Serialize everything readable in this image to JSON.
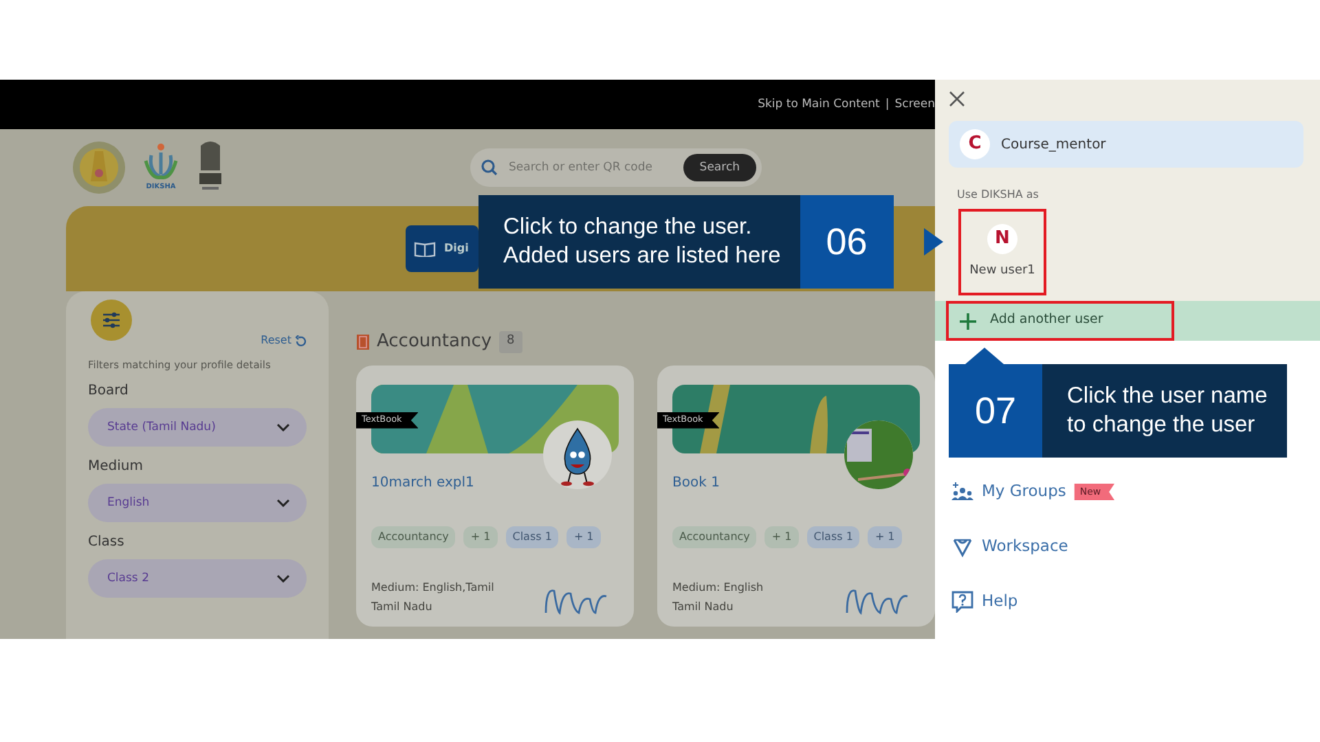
{
  "top_bar": {
    "links": [
      {
        "label": "Skip to Main Content"
      },
      {
        "label": "Screen"
      }
    ],
    "separator": "|"
  },
  "header": {
    "logo_label": "DIKSHA",
    "search": {
      "placeholder": "Search or enter QR code",
      "button": "Search"
    }
  },
  "banner": {
    "button": "Digi"
  },
  "filters": {
    "reset": "Reset",
    "note": "Filters matching your profile details",
    "fields": [
      {
        "label": "Board",
        "value": "State (Tamil Nadu)"
      },
      {
        "label": "Medium",
        "value": "English"
      },
      {
        "label": "Class",
        "value": "Class 2"
      }
    ]
  },
  "section": {
    "title": "Accountancy",
    "count": "8"
  },
  "cards": [
    {
      "tag": "TextBook",
      "title": "10march expl1",
      "kind": "mascot",
      "chips": [
        {
          "text": "Accountancy",
          "kind": "subject"
        },
        {
          "text": "+ 1",
          "kind": "subject"
        },
        {
          "text": "Class 1",
          "kind": "class"
        },
        {
          "text": "+ 1",
          "kind": "class"
        }
      ],
      "medium": "Medium: English,Tamil",
      "board": "Tamil Nadu"
    },
    {
      "tag": "TextBook",
      "title": "Book 1",
      "kind": "calendar",
      "chips": [
        {
          "text": "Accountancy",
          "kind": "subject"
        },
        {
          "text": "+ 1",
          "kind": "subject"
        },
        {
          "text": "Class 1",
          "kind": "class"
        },
        {
          "text": "+ 1",
          "kind": "class"
        }
      ],
      "medium": "Medium: English",
      "board": "Tamil Nadu"
    }
  ],
  "drawer": {
    "profile": {
      "initial": "C",
      "name": "Course_mentor"
    },
    "use_as": "Use DIKSHA as",
    "users": [
      {
        "initial": "N",
        "name": "New user1",
        "highlighted": true
      }
    ],
    "add_user": {
      "label": "Add another user",
      "highlighted": true
    },
    "menu": [
      {
        "label": "My Groups",
        "kind": "groups",
        "badge": "New"
      },
      {
        "label": "Workspace",
        "kind": "workspace"
      },
      {
        "label": "Help",
        "kind": "help"
      }
    ]
  },
  "callouts": [
    {
      "number": "06",
      "text": "Click to change the user.\nAdded users are listed here"
    },
    {
      "number": "07",
      "text": "Click the user name\nto change the user"
    }
  ]
}
